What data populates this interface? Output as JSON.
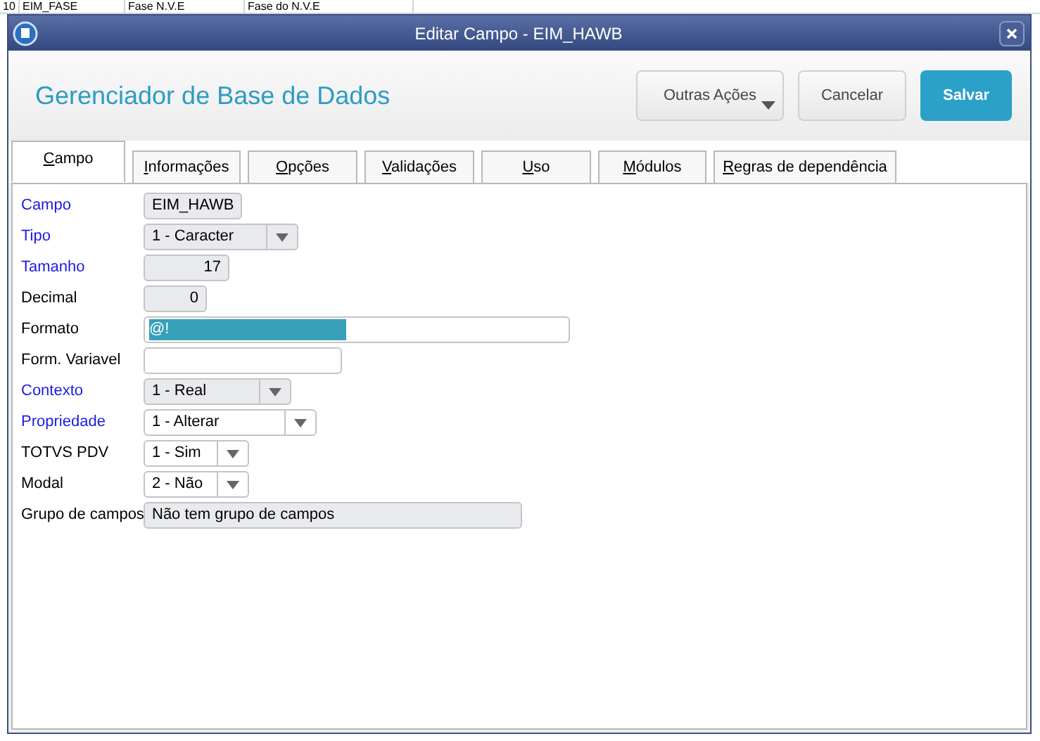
{
  "background_row": {
    "cells": [
      "10",
      "EIM_FASE",
      "Fase N.V.E",
      "Fase do N.V.E"
    ]
  },
  "window": {
    "title": "Editar Campo - EIM_HAWB"
  },
  "header": {
    "title": "Gerenciador de Base de Dados",
    "buttons": [
      {
        "label": "Outras Ações",
        "kind": "menu"
      },
      {
        "label": "Cancelar",
        "kind": "default"
      },
      {
        "label": "Salvar",
        "kind": "primary"
      }
    ]
  },
  "tabs": [
    {
      "label": "Campo",
      "selected": true
    },
    {
      "label": "Informações",
      "selected": false
    },
    {
      "label": "Opções",
      "selected": false
    },
    {
      "label": "Validações",
      "selected": false
    },
    {
      "label": "Uso",
      "selected": false
    },
    {
      "label": "Módulos",
      "selected": false
    },
    {
      "label": "Regras de dependência",
      "selected": false
    }
  ],
  "fields": [
    {
      "label": "Campo",
      "required": true,
      "kind": "text",
      "value": "EIM_HAWB",
      "disabled": true
    },
    {
      "label": "Tipo",
      "required": true,
      "kind": "select",
      "value": "1 - Caracter",
      "disabled": true
    },
    {
      "label": "Tamanho",
      "required": true,
      "kind": "number",
      "value": "17",
      "disabled": true
    },
    {
      "label": "Decimal",
      "required": false,
      "kind": "number",
      "value": "0",
      "disabled": true
    },
    {
      "label": "Formato",
      "required": false,
      "kind": "text",
      "value": "@!",
      "disabled": false,
      "highlighted": true
    },
    {
      "label": "Form. Variavel",
      "required": false,
      "kind": "text",
      "disabled": false
    },
    {
      "label": "Contexto",
      "required": true,
      "kind": "select",
      "value": "1 - Real",
      "disabled": true
    },
    {
      "label": "Propriedade",
      "required": true,
      "kind": "select",
      "value": "1 - Alterar",
      "disabled": false
    },
    {
      "label": "TOTVS PDV",
      "required": false,
      "kind": "select",
      "value": "1 - Sim",
      "disabled": false
    },
    {
      "label": "Modal",
      "required": false,
      "kind": "select",
      "value": "2 - Não",
      "disabled": false
    },
    {
      "label": "Grupo de campos",
      "required": false,
      "kind": "text",
      "value": "Não tem grupo de campos",
      "disabled": true
    }
  ]
}
